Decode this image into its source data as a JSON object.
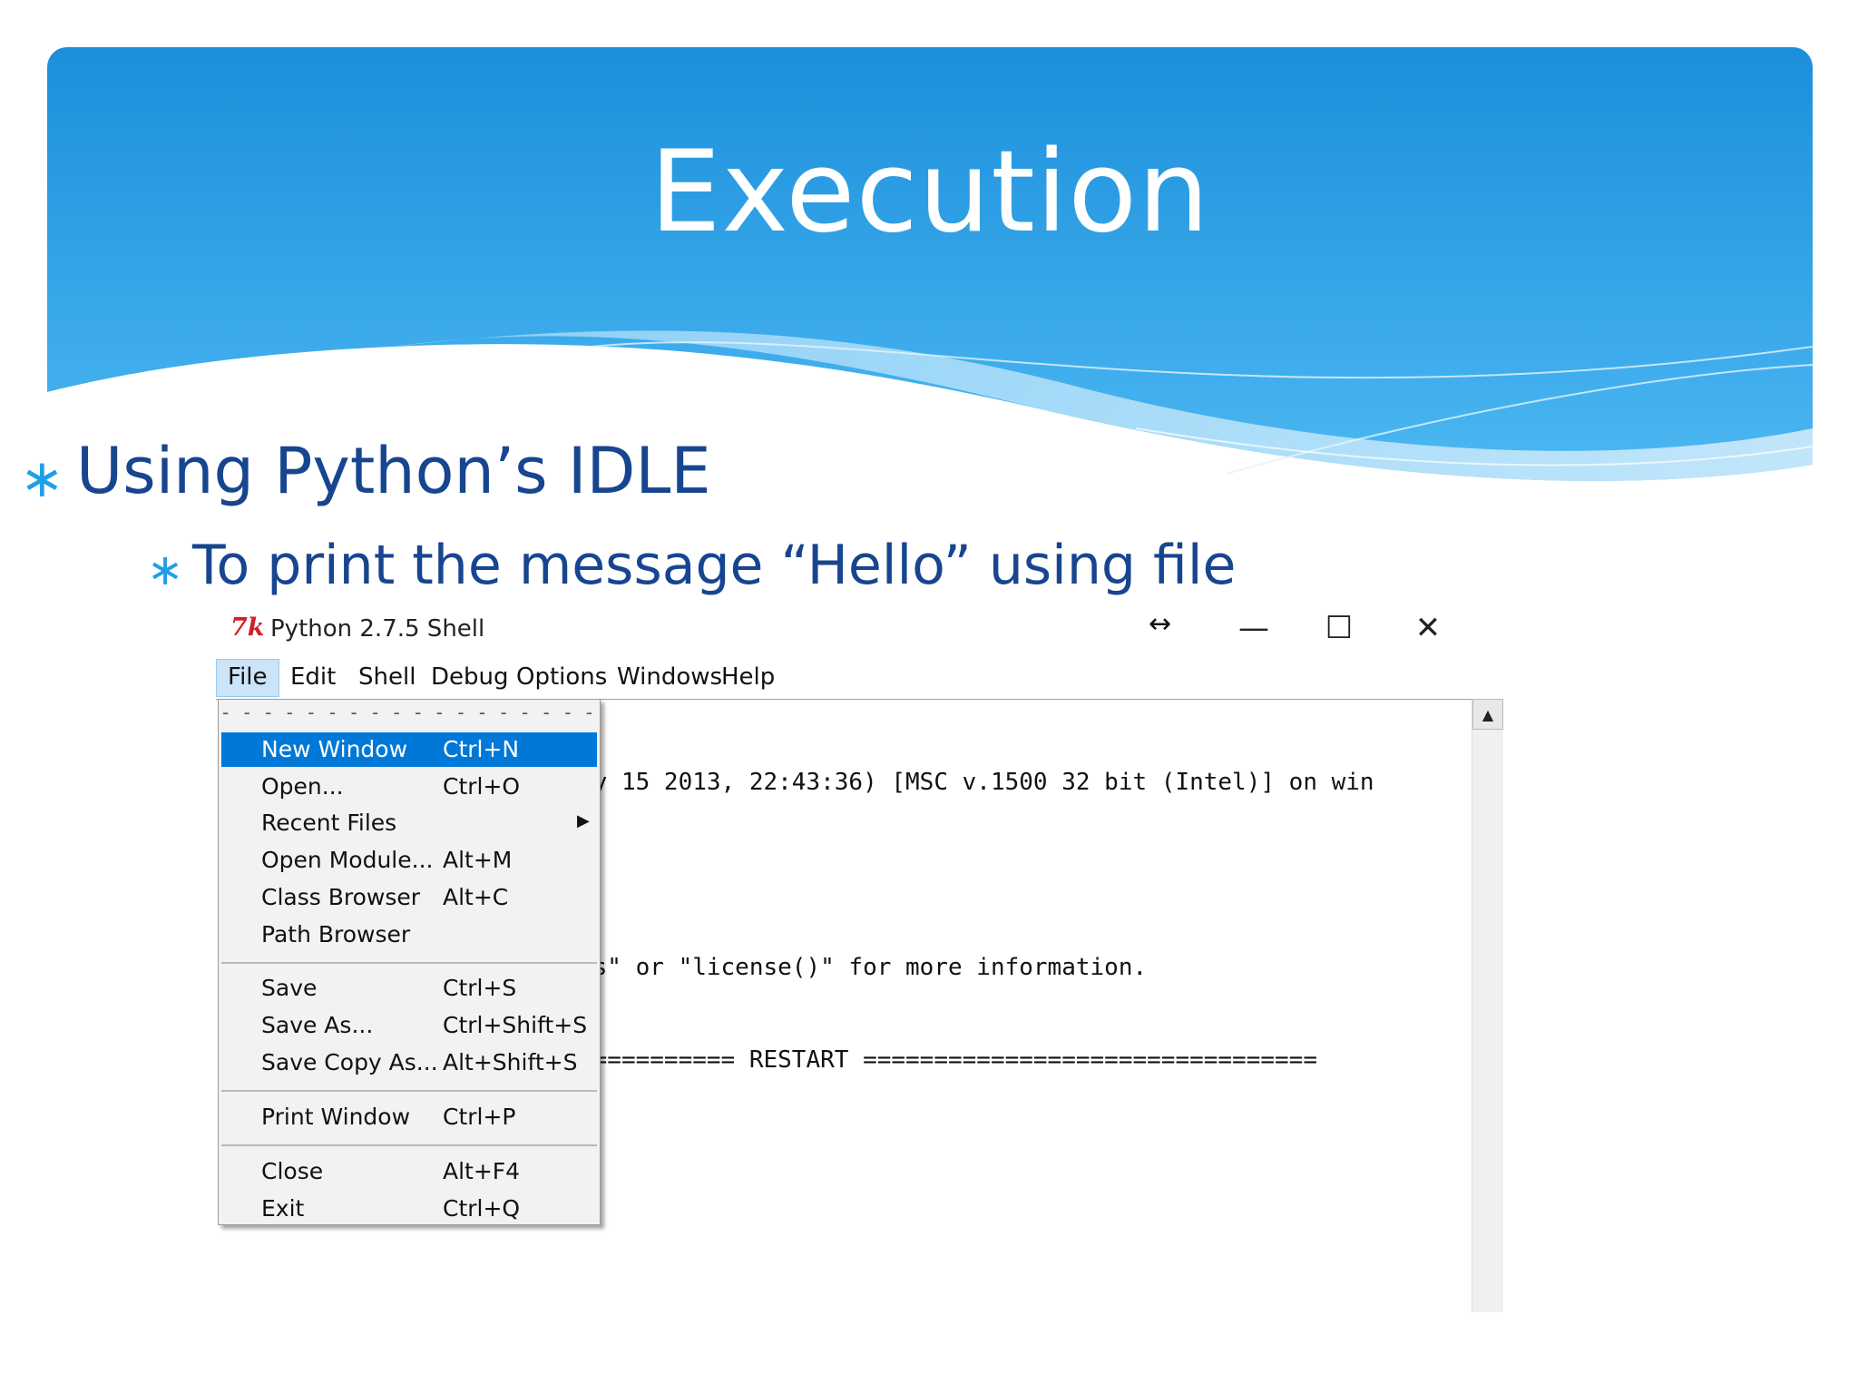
{
  "slide": {
    "title": "Execution",
    "bullet1": "Using Python’s IDLE",
    "bullet2": "To print the message “Hello” using file",
    "bullet_marker": "∗"
  },
  "window": {
    "title": "Python 2.7.5 Shell",
    "icon": "7k",
    "icon_name": "idle-tk-icon",
    "controls": {
      "minimize": "—",
      "maximize": "☐",
      "close": "✕"
    }
  },
  "menubar": [
    "File",
    "Edit",
    "Shell",
    "Debug",
    "Options",
    "Windows",
    "Help"
  ],
  "shell": {
    "lines": [
      "ay 15 2013, 22:43:36) [MSC v.1500 32 bit (Intel)] on win",
      "",
      "ts\" or \"license()\" for more information.",
      "=========== RESTART ================================"
    ]
  },
  "file_menu": {
    "tearoff": "- - - - - - - - - - - - - - - - - - -",
    "groups": [
      [
        {
          "label": "New Window",
          "accel": "Ctrl+N",
          "selected": true
        },
        {
          "label": "Open...",
          "accel": "Ctrl+O"
        },
        {
          "label": "Recent Files",
          "accel": "",
          "submenu": true
        },
        {
          "label": "Open Module...",
          "accel": "Alt+M"
        },
        {
          "label": "Class Browser",
          "accel": "Alt+C"
        },
        {
          "label": "Path Browser",
          "accel": ""
        }
      ],
      [
        {
          "label": "Save",
          "accel": "Ctrl+S"
        },
        {
          "label": "Save As...",
          "accel": "Ctrl+Shift+S"
        },
        {
          "label": "Save Copy As...",
          "accel": "Alt+Shift+S"
        }
      ],
      [
        {
          "label": "Print Window",
          "accel": "Ctrl+P"
        }
      ],
      [
        {
          "label": "Close",
          "accel": "Alt+F4"
        },
        {
          "label": "Exit",
          "accel": "Ctrl+Q"
        }
      ]
    ]
  },
  "colors": {
    "header_top": "#1c8fdc",
    "header_bottom": "#45b4f0",
    "bullet_text": "#17458f",
    "bullet_marker": "#1fa0e6",
    "menu_selected": "#0078d7"
  }
}
